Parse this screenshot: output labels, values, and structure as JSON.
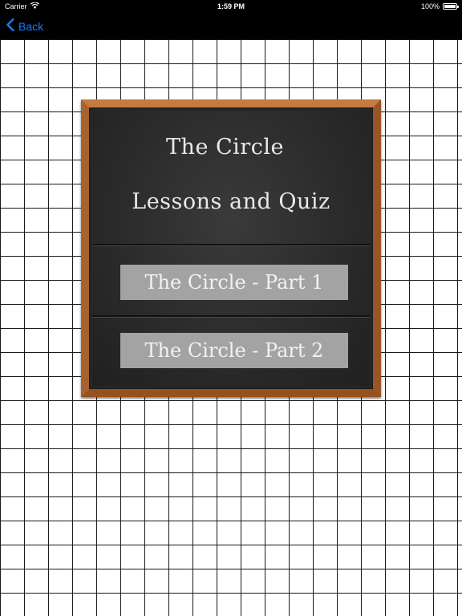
{
  "status_bar": {
    "carrier": "Carrier",
    "time": "1:59 PM",
    "battery_text": "100%",
    "battery_level": 1.0
  },
  "nav": {
    "back_label": "Back"
  },
  "board": {
    "title_line1": "The Circle",
    "title_line2": "Lessons and Quiz",
    "buttons": [
      {
        "label": "The Circle - Part 1"
      },
      {
        "label": "The Circle - Part 2"
      }
    ]
  },
  "colors": {
    "nav_accent": "#1b7bf5",
    "frame_wood": "#b06a35",
    "chalkboard": "#2a2a2a",
    "button_bg": "#a3a3a3"
  }
}
